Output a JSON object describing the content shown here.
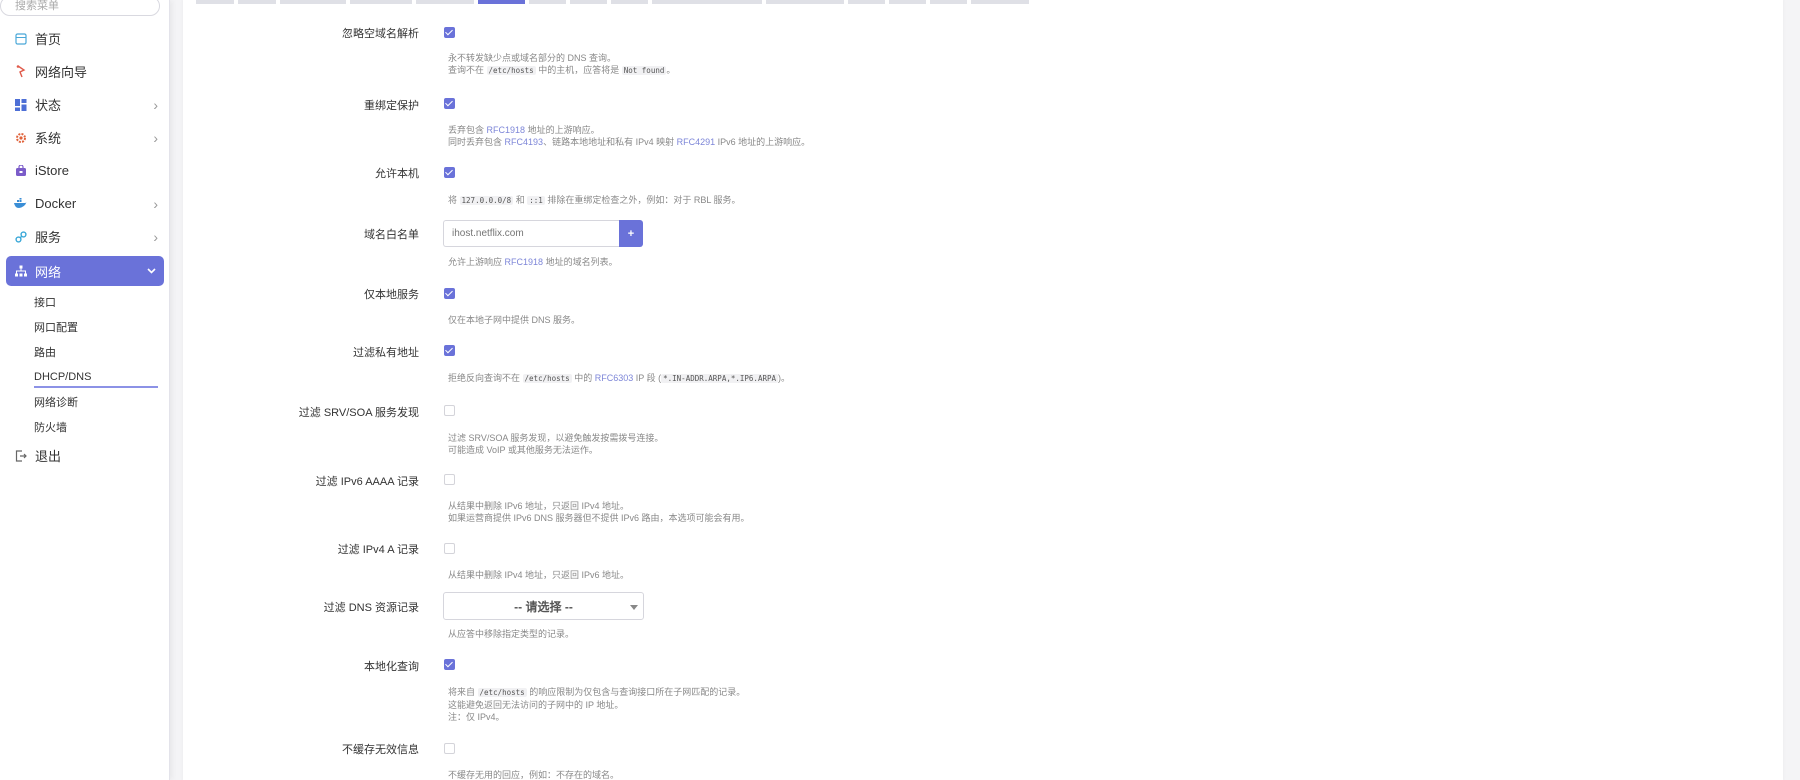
{
  "sidebar": {
    "search_placeholder": "搜索菜单",
    "items": [
      {
        "label": "首页"
      },
      {
        "label": "网络向导"
      },
      {
        "label": "状态",
        "chevron": "›"
      },
      {
        "label": "系统",
        "chevron": "›"
      },
      {
        "label": "iStore"
      },
      {
        "label": "Docker",
        "chevron": "›"
      },
      {
        "label": "服务",
        "chevron": "›"
      },
      {
        "label": "网络",
        "chevron": "⌄"
      }
    ],
    "sub_items": [
      "接口",
      "网口配置",
      "路由",
      "DHCP/DNS",
      "网络诊断",
      "防火墙"
    ],
    "logout": "退出"
  },
  "form": {
    "r1": {
      "label": "忽略空域名解析",
      "d1": "永不转发缺少点或域名部分的 DNS 查询。",
      "d2a": "查询不在",
      "d2code": "/etc/hosts",
      "d2b": "中的主机，应答将是",
      "d2code2": "Not found",
      "d2c": "。"
    },
    "r2": {
      "label": "重绑定保护",
      "d1a": "丢弃包含",
      "d1link": "RFC1918",
      "d1b": "地址的上游响应。",
      "d2a": "同时丢弃包含",
      "d2link": "RFC4193",
      "d2b": "、链路本地地址和私有 IPv4 映射",
      "d2link2": "RFC4291",
      "d2c": "IPv6 地址的上游响应。"
    },
    "r3": {
      "label": "允许本机",
      "da": "将",
      "code1": "127.0.0.0/8",
      "db": "和",
      "code2": "::1",
      "dc": "排除在重绑定检查之外，例如：对于 RBL 服务。"
    },
    "r4": {
      "label": "域名白名单",
      "placeholder": "ihost.netflix.com",
      "add": "+",
      "da": "允许上游响应",
      "link": "RFC1918",
      "db": "地址的域名列表。"
    },
    "r5": {
      "label": "仅本地服务",
      "d": "仅在本地子网中提供 DNS 服务。"
    },
    "r6": {
      "label": "过滤私有地址",
      "da": "拒绝反向查询不在",
      "code1": "/etc/hosts",
      "db": "中的",
      "link": "RFC6303",
      "dc": "IP 段 (",
      "code2": "*.IN-ADDR.ARPA,*.IP6.ARPA",
      "dd": ")。"
    },
    "r7": {
      "label": "过滤 SRV/SOA 服务发现",
      "d1": "过滤 SRV/SOA 服务发现，以避免触发按需拨号连接。",
      "d2": "可能造成 VoIP 或其他服务无法运作。"
    },
    "r8": {
      "label": "过滤 IPv6 AAAA 记录",
      "d1": "从结果中删除 IPv6 地址，只返回 IPv4 地址。",
      "d2": "如果运营商提供 IPv6 DNS 服务器但不提供 IPv6 路由，本选项可能会有用。"
    },
    "r9": {
      "label": "过滤 IPv4 A 记录",
      "d": "从结果中删除 IPv4 地址，只返回 IPv6 地址。"
    },
    "r10": {
      "label": "过滤 DNS 资源记录",
      "select": "-- 请选择 --",
      "d": "从应答中移除指定类型的记录。"
    },
    "r11": {
      "label": "本地化查询",
      "d1a": "将来自",
      "code": "/etc/hosts",
      "d1b": "的响应限制为仅包含与查询接口所在子网匹配的记录。",
      "d2": "这能避免返回无法访问的子网中的 IP 地址。",
      "d3": "注：仅 IPv4。"
    },
    "r12": {
      "label": "不缓存无效信息",
      "d": "不缓存无用的回应，例如：不存在的域名。"
    }
  },
  "colors": {
    "accent": "#6a72d9",
    "link": "#7d86d8"
  }
}
